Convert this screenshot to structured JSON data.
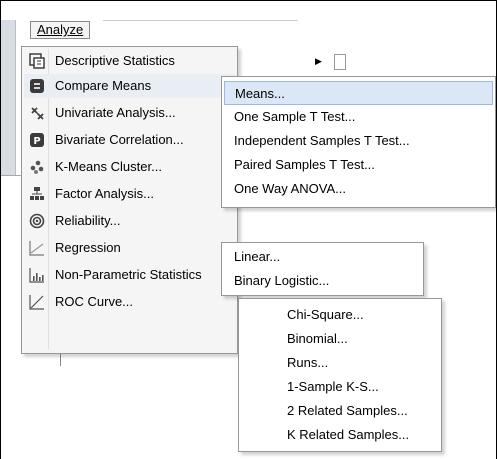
{
  "menubar": {
    "analyze_label": "Analyze"
  },
  "main_menu": {
    "items": [
      {
        "label": "Descriptive Statistics",
        "icon": "descriptive-stats-icon",
        "has_submenu": true
      },
      {
        "label": "Compare Means",
        "icon": "compare-means-icon",
        "has_submenu": true,
        "highlighted": true
      },
      {
        "label": "Univariate Analysis...",
        "icon": "univariate-icon"
      },
      {
        "label": "Bivariate Correlation...",
        "icon": "bivariate-icon"
      },
      {
        "label": "K-Means Cluster...",
        "icon": "kmeans-icon"
      },
      {
        "label": "Factor Analysis...",
        "icon": "factor-analysis-icon"
      },
      {
        "label": "Reliability...",
        "icon": "reliability-icon"
      },
      {
        "label": "Regression",
        "icon": "regression-icon",
        "has_submenu": true
      },
      {
        "label": "Non-Parametric Statistics",
        "icon": "nonparametric-icon",
        "has_submenu": true
      },
      {
        "label": "ROC Curve...",
        "icon": "roc-curve-icon"
      }
    ]
  },
  "compare_means_submenu": {
    "items": [
      {
        "label": "Means...",
        "highlighted": true
      },
      {
        "label": "One Sample T Test..."
      },
      {
        "label": "Independent Samples T Test..."
      },
      {
        "label": "Paired Samples T Test..."
      },
      {
        "label": "One Way ANOVA..."
      }
    ]
  },
  "regression_submenu": {
    "items": [
      {
        "label": "Linear..."
      },
      {
        "label": "Binary Logistic..."
      }
    ]
  },
  "nonparametric_submenu": {
    "items": [
      {
        "label": "Chi-Square..."
      },
      {
        "label": "Binomial..."
      },
      {
        "label": "Runs..."
      },
      {
        "label": "1-Sample K-S..."
      },
      {
        "label": "2 Related Samples..."
      },
      {
        "label": "K Related Samples..."
      }
    ]
  },
  "colors": {
    "highlight_bg": "#dfe8f5",
    "highlight_border": "#a9c1e2",
    "menu_bg": "#f5f5f5",
    "icon_dark": "#3a3a3a",
    "icon_blue": "#3c6eb4"
  }
}
